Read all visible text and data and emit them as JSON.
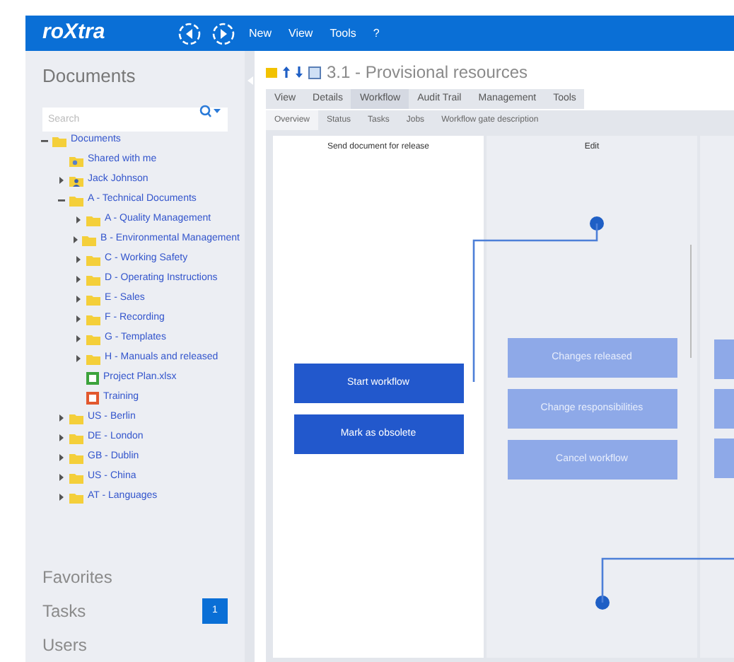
{
  "app": {
    "logo": "roXtra",
    "menu": [
      "New",
      "View",
      "Tools",
      "?"
    ]
  },
  "sidebar": {
    "title": "Documents",
    "search": {
      "placeholder": "Search"
    },
    "tree": [
      {
        "label": "Documents",
        "kind": "folder",
        "expanded": true,
        "children": [
          {
            "label": "Shared with me",
            "kind": "shared"
          },
          {
            "label": "Jack Johnson",
            "kind": "user",
            "expanded": false
          },
          {
            "label": "A - Technical Documents",
            "kind": "folder",
            "expanded": true,
            "children": [
              {
                "label": "A - Quality Management",
                "kind": "folder",
                "expanded": false
              },
              {
                "label": "B - Environmental Management",
                "kind": "folder",
                "expanded": false
              },
              {
                "label": "C - Working Safety",
                "kind": "folder",
                "expanded": false
              },
              {
                "label": "D - Operating Instructions",
                "kind": "folder",
                "expanded": false
              },
              {
                "label": "E - Sales",
                "kind": "folder",
                "expanded": false
              },
              {
                "label": "F - Recording",
                "kind": "folder",
                "expanded": false
              },
              {
                "label": "G - Templates",
                "kind": "folder",
                "expanded": false
              },
              {
                "label": "H - Manuals and released",
                "kind": "folder",
                "expanded": false
              },
              {
                "label": "Project Plan.xlsx",
                "kind": "sheet"
              },
              {
                "label": "Training",
                "kind": "slides"
              }
            ]
          },
          {
            "label": "US - Berlin",
            "kind": "folder",
            "expanded": false
          },
          {
            "label": "DE - London",
            "kind": "folder",
            "expanded": false
          },
          {
            "label": "GB - Dublin",
            "kind": "folder",
            "expanded": false
          },
          {
            "label": "US - China",
            "kind": "folder",
            "expanded": false
          },
          {
            "label": "AT - Languages",
            "kind": "folder",
            "expanded": false
          }
        ]
      }
    ],
    "sections": [
      {
        "label": "Favorites"
      },
      {
        "label": "Tasks",
        "badge": "1"
      },
      {
        "label": "Users"
      }
    ]
  },
  "document": {
    "title": "3.1 - Provisional resources",
    "tabs": [
      {
        "label": "View",
        "selected": false
      },
      {
        "label": "Details",
        "selected": false
      },
      {
        "label": "Workflow",
        "selected": true
      },
      {
        "label": "Audit Trail",
        "selected": false
      },
      {
        "label": "Management",
        "selected": false
      },
      {
        "label": "Tools",
        "selected": false
      }
    ],
    "subtabs": [
      {
        "label": "Overview",
        "selected": true
      },
      {
        "label": "Status",
        "selected": false
      },
      {
        "label": "Tasks",
        "selected": false
      },
      {
        "label": "Jobs",
        "selected": false
      },
      {
        "label": "Workflow gate description",
        "selected": false
      }
    ],
    "lanes": [
      {
        "title": "Send document for release",
        "active": true,
        "steps": [
          {
            "label": "Start workflow"
          },
          {
            "label": "Mark as obsolete"
          }
        ]
      },
      {
        "title": "Edit",
        "active": false,
        "steps": [
          {
            "label": "Changes released"
          },
          {
            "label": "Change responsibilities"
          },
          {
            "label": "Cancel workflow"
          }
        ]
      }
    ]
  }
}
